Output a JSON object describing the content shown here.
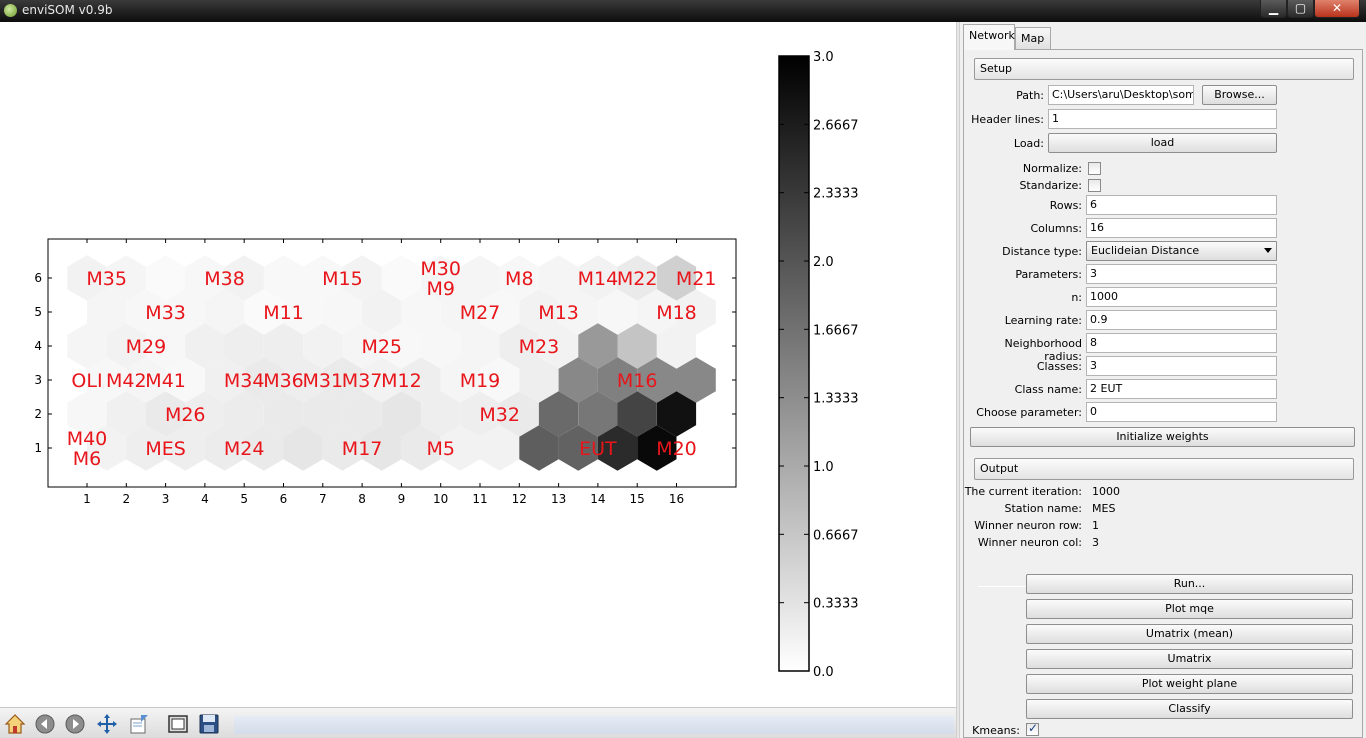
{
  "window": {
    "title": "enviSOM v0.9b",
    "minimize": "▁",
    "maximize": "▢",
    "close": "✕"
  },
  "colorbar": {
    "min": 0.0,
    "max": 3.0,
    "ticks": [
      "3.0",
      "2.6667",
      "2.3333",
      "2.0",
      "1.6667",
      "1.3333",
      "1.0",
      "0.6667",
      "0.3333",
      "0.0"
    ]
  },
  "chart_data": {
    "type": "heatmap",
    "rows": 6,
    "columns": 16,
    "x_ticks": [
      "1",
      "2",
      "3",
      "4",
      "5",
      "6",
      "7",
      "8",
      "9",
      "10",
      "11",
      "12",
      "13",
      "14",
      "15",
      "16"
    ],
    "y_ticks": [
      "6",
      "5",
      "4",
      "3",
      "2",
      "1"
    ],
    "hex_values": [
      [
        0.15,
        0.12,
        0.06,
        0.1,
        0.15,
        0.08,
        0.08,
        0.14,
        0.06,
        0.12,
        0.12,
        0.1,
        0.12,
        0.15,
        0.25,
        0.55
      ],
      [
        0.12,
        0.1,
        0.1,
        0.12,
        0.06,
        0.08,
        0.1,
        0.15,
        0.1,
        0.12,
        0.08,
        0.15,
        0.12,
        0.1,
        0.12,
        0.15
      ],
      [
        0.12,
        0.15,
        0.1,
        0.18,
        0.2,
        0.2,
        0.15,
        0.12,
        0.08,
        0.1,
        0.12,
        0.2,
        0.15,
        1.2,
        0.7,
        0.15
      ],
      [
        0.1,
        0.12,
        0.08,
        0.18,
        0.25,
        0.2,
        0.25,
        0.15,
        0.2,
        0.12,
        0.08,
        0.2,
        1.4,
        1.5,
        1.4,
        1.4
      ],
      [
        0.1,
        0.18,
        0.25,
        0.2,
        0.22,
        0.25,
        0.25,
        0.25,
        0.3,
        0.2,
        0.2,
        0.25,
        1.75,
        1.6,
        2.2,
        2.8
      ],
      [
        0.15,
        0.2,
        0.2,
        0.22,
        0.25,
        0.3,
        0.25,
        0.3,
        0.25,
        0.15,
        0.15,
        1.9,
        1.85,
        2.5,
        2.9,
        0.0
      ]
    ],
    "labels": [
      {
        "text": "M35",
        "col": 1.5,
        "row": 6
      },
      {
        "text": "M38",
        "col": 4.5,
        "row": 6
      },
      {
        "text": "M15",
        "col": 7.5,
        "row": 6
      },
      {
        "text": "M30",
        "col": 10.0,
        "row": 6.3
      },
      {
        "text": "M9",
        "col": 10.0,
        "row": 5.7
      },
      {
        "text": "M8",
        "col": 12.0,
        "row": 6
      },
      {
        "text": "M14",
        "col": 14.0,
        "row": 6
      },
      {
        "text": "M22",
        "col": 15.0,
        "row": 6
      },
      {
        "text": "M21",
        "col": 16.5,
        "row": 6
      },
      {
        "text": "M33",
        "col": 3.0,
        "row": 5
      },
      {
        "text": "M11",
        "col": 6.0,
        "row": 5
      },
      {
        "text": "M27",
        "col": 11.0,
        "row": 5
      },
      {
        "text": "M13",
        "col": 13.0,
        "row": 5
      },
      {
        "text": "M18",
        "col": 16.0,
        "row": 5
      },
      {
        "text": "M29",
        "col": 2.5,
        "row": 4
      },
      {
        "text": "M25",
        "col": 8.5,
        "row": 4
      },
      {
        "text": "M23",
        "col": 12.5,
        "row": 4
      },
      {
        "text": "OLI",
        "col": 1.0,
        "row": 3
      },
      {
        "text": "M42",
        "col": 2.0,
        "row": 3
      },
      {
        "text": "M41",
        "col": 3.0,
        "row": 3
      },
      {
        "text": "M34",
        "col": 5.0,
        "row": 3
      },
      {
        "text": "M36",
        "col": 6.0,
        "row": 3
      },
      {
        "text": "M31",
        "col": 7.0,
        "row": 3
      },
      {
        "text": "M37",
        "col": 8.0,
        "row": 3
      },
      {
        "text": "M12",
        "col": 9.0,
        "row": 3
      },
      {
        "text": "M19",
        "col": 11.0,
        "row": 3
      },
      {
        "text": "M16",
        "col": 15.0,
        "row": 3
      },
      {
        "text": "M26",
        "col": 3.5,
        "row": 2
      },
      {
        "text": "M32",
        "col": 11.5,
        "row": 2
      },
      {
        "text": "M40",
        "col": 1.0,
        "row": 1.3
      },
      {
        "text": "M6",
        "col": 1.0,
        "row": 0.7
      },
      {
        "text": "MES",
        "col": 3.0,
        "row": 1
      },
      {
        "text": "M24",
        "col": 5.0,
        "row": 1
      },
      {
        "text": "M17",
        "col": 8.0,
        "row": 1
      },
      {
        "text": "M5",
        "col": 10.0,
        "row": 1
      },
      {
        "text": "EUT",
        "col": 14.0,
        "row": 1
      },
      {
        "text": "M20",
        "col": 16.0,
        "row": 1
      }
    ],
    "colormap": "gray_r",
    "vmin": 0.0,
    "vmax": 3.0
  },
  "toolbar": {
    "icons": [
      "home-icon",
      "back-icon",
      "forward-icon",
      "pan-icon",
      "edit-axis-icon",
      "subplots-icon",
      "save-icon"
    ]
  },
  "tabs": {
    "network": "Network",
    "map": "Map"
  },
  "setup": {
    "header": "Setup",
    "path_label": "Path:",
    "path_value": "C:\\Users\\aru\\Desktop\\som_k",
    "browse": "Browse...",
    "header_lines_label": "Header lines:",
    "header_lines_value": "1",
    "load_label": "Load:",
    "load_button": "load",
    "normalize_label": "Normalize:",
    "standarize_label": "Standarize:",
    "rows_label": "Rows:",
    "rows_value": "6",
    "columns_label": "Columns:",
    "columns_value": "16",
    "distance_label": "Distance type:",
    "distance_value": "Euclideian Distance",
    "parameters_label": "Parameters:",
    "parameters_value": "3",
    "n_label": "n:",
    "n_value": "1000",
    "learning_rate_label": "Learning rate:",
    "learning_rate_value": "0.9",
    "neighborhood_label": "Neighborhood radius:",
    "neighborhood_value": "8",
    "classes_label": "Classes:",
    "classes_value": "3",
    "class_name_label": "Class name:",
    "class_name_value": "2 EUT",
    "choose_param_label": "Choose parameter:",
    "choose_param_value": "0",
    "init_weights": "Initialize weights"
  },
  "output": {
    "header": "Output",
    "iteration_label": "The current iteration:",
    "iteration_value": "1000",
    "station_label": "Station name:",
    "station_value": "MES",
    "winner_row_label": "Winner neuron row:",
    "winner_row_value": "1",
    "winner_col_label": "Winner neuron col:",
    "winner_col_value": "3"
  },
  "actions": {
    "run": "Run...",
    "plot_mqe": "Plot mqe",
    "umatrix_mean": "Umatrix (mean)",
    "umatrix": "Umatrix",
    "plot_weight_plane": "Plot weight plane",
    "classify": "Classify",
    "kmeans_label": "Kmeans:"
  },
  "colors": {
    "label_red": "#e8151b",
    "title_bar": "#111111",
    "panel_bg": "#f0f0f0"
  }
}
